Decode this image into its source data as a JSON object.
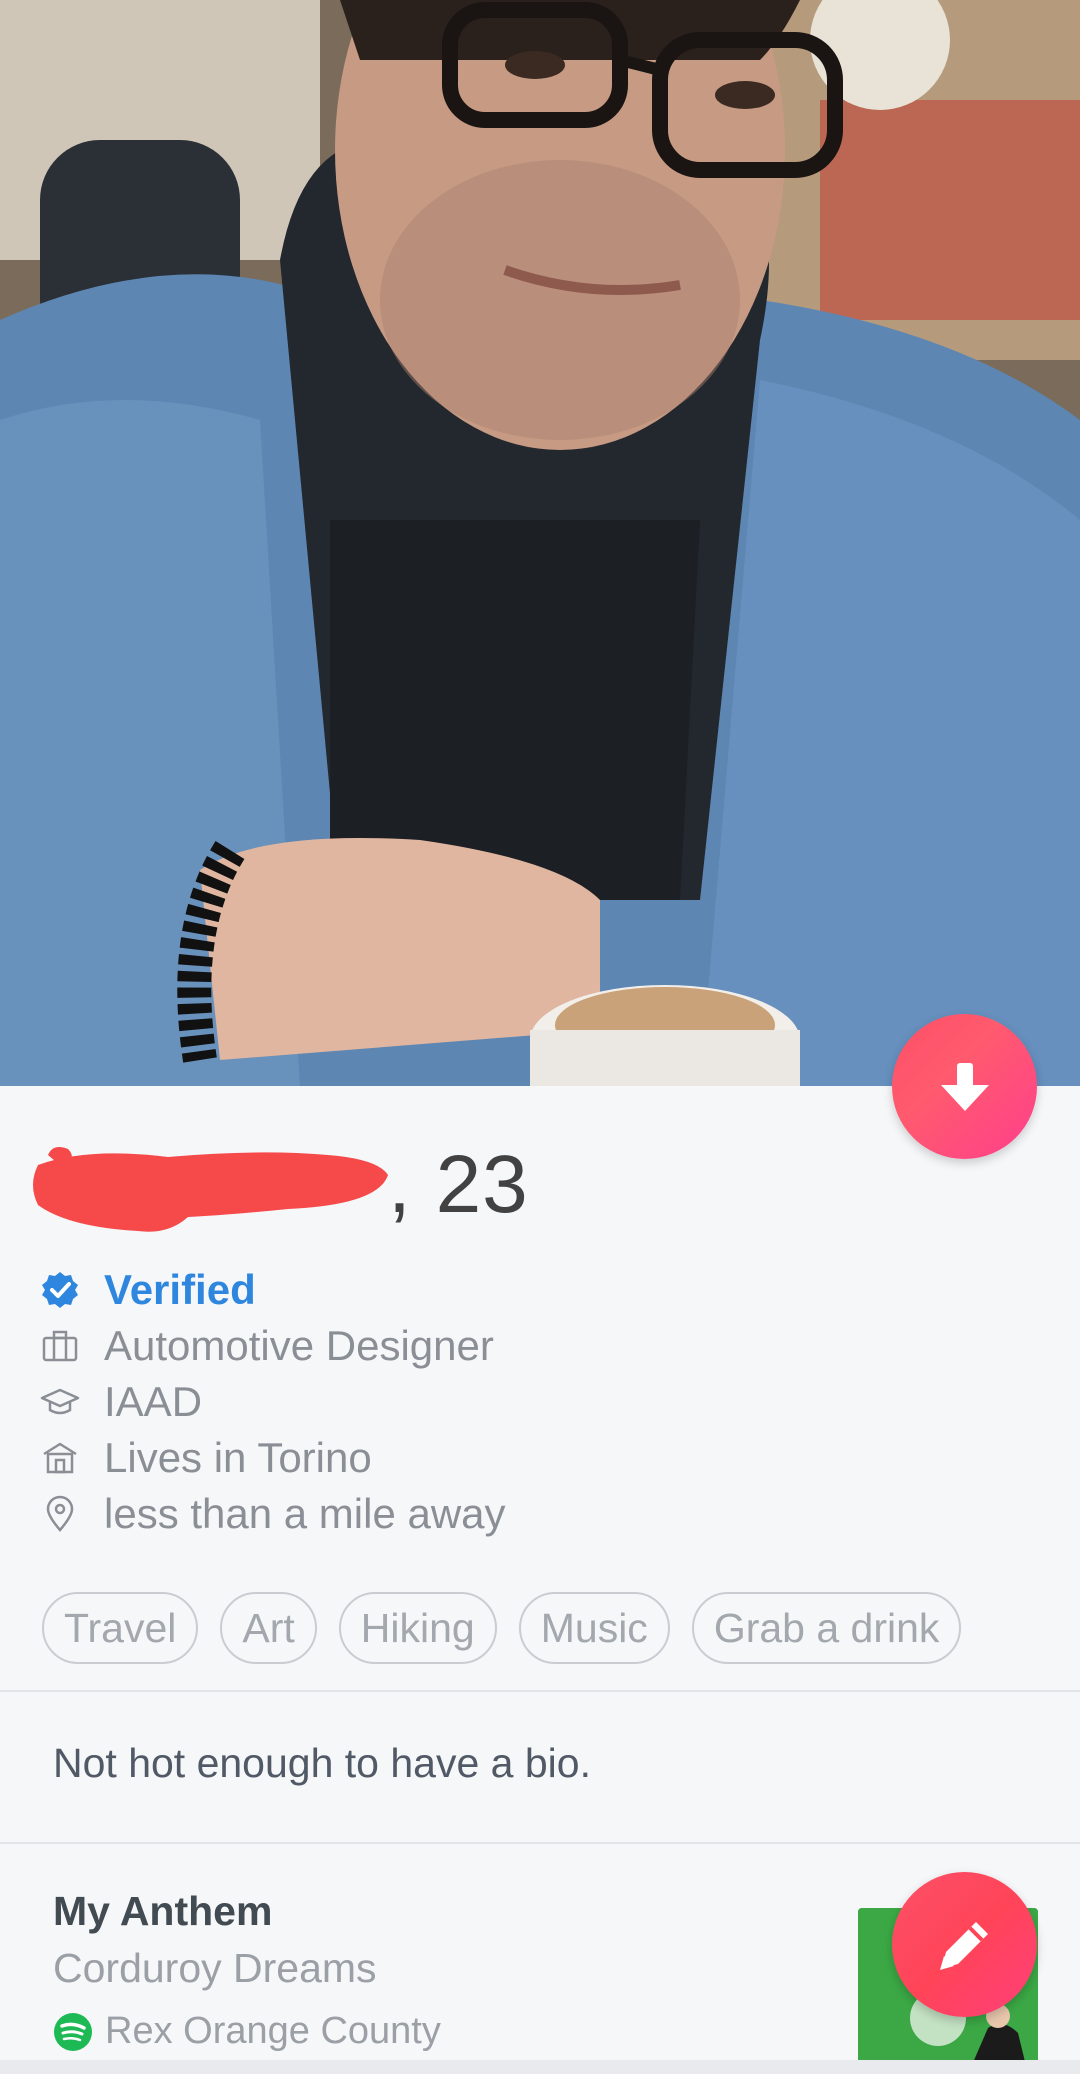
{
  "profile": {
    "age_suffix": ", 23",
    "verified_label": "Verified",
    "job": "Automotive Designer",
    "school": "IAAD",
    "lives_in": "Lives in Torino",
    "distance": "less than a mile away"
  },
  "interests": [
    "Travel",
    "Art",
    "Hiking",
    "Music",
    "Grab a drink"
  ],
  "bio": "Not hot enough to have a bio.",
  "anthem": {
    "title": "My Anthem",
    "song": "Corduroy Dreams",
    "artist": "Rex Orange County"
  },
  "icons": {
    "collapse": "arrow-down-icon",
    "edit": "pencil-icon",
    "verified": "verified-badge-icon",
    "job": "briefcase-icon",
    "school": "graduation-cap-icon",
    "home": "home-icon",
    "location": "location-pin-icon",
    "spotify": "spotify-icon"
  },
  "colors": {
    "accent": "#fd5068",
    "verified": "#2e86de",
    "spotify": "#1db954"
  }
}
